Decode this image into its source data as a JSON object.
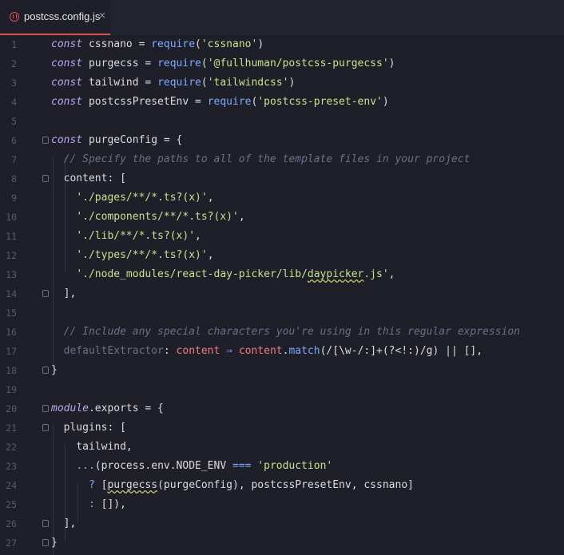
{
  "tab": {
    "title": "postcss.config.js",
    "close": "×"
  },
  "colors": {
    "accent": "#d9534f",
    "background": "#1e1f29"
  },
  "icons": {
    "tab_icon": "npm-file-icon",
    "fold": "fold-marker-icon"
  },
  "lines": [
    {
      "n": "1",
      "t": [
        {
          "c": "kw",
          "v": "const"
        },
        {
          "c": "p",
          "v": " cssnano = "
        },
        {
          "c": "fn",
          "v": "require"
        },
        {
          "c": "p",
          "v": "("
        },
        {
          "c": "str",
          "v": "'cssnano'"
        },
        {
          "c": "p",
          "v": ")"
        }
      ]
    },
    {
      "n": "2",
      "t": [
        {
          "c": "kw",
          "v": "const"
        },
        {
          "c": "p",
          "v": " purgecss = "
        },
        {
          "c": "fn",
          "v": "require"
        },
        {
          "c": "p",
          "v": "("
        },
        {
          "c": "str",
          "v": "'@fullhuman/postcss-purgecss'"
        },
        {
          "c": "p",
          "v": ")"
        }
      ]
    },
    {
      "n": "3",
      "t": [
        {
          "c": "kw",
          "v": "const"
        },
        {
          "c": "p",
          "v": " tailwind = "
        },
        {
          "c": "fn",
          "v": "require"
        },
        {
          "c": "p",
          "v": "("
        },
        {
          "c": "str",
          "v": "'tailwindcss'"
        },
        {
          "c": "p",
          "v": ")"
        }
      ]
    },
    {
      "n": "4",
      "t": [
        {
          "c": "kw",
          "v": "const"
        },
        {
          "c": "p",
          "v": " postcssPresetEnv = "
        },
        {
          "c": "fn",
          "v": "require"
        },
        {
          "c": "p",
          "v": "("
        },
        {
          "c": "str",
          "v": "'postcss-preset-env'"
        },
        {
          "c": "p",
          "v": ")"
        }
      ]
    },
    {
      "n": "5",
      "t": []
    },
    {
      "n": "6",
      "fold": true,
      "t": [
        {
          "c": "kw",
          "v": "const"
        },
        {
          "c": "p",
          "v": " purgeConfig = {"
        }
      ]
    },
    {
      "n": "7",
      "t": [
        {
          "c": "cm",
          "v": "  // Specify the paths to all of the template files in your project"
        }
      ]
    },
    {
      "n": "8",
      "fold": true,
      "t": [
        {
          "c": "p",
          "v": "  content: ["
        }
      ]
    },
    {
      "n": "9",
      "t": [
        {
          "c": "p",
          "v": "    "
        },
        {
          "c": "str",
          "v": "'./pages/**/*.ts?(x)'"
        },
        {
          "c": "p",
          "v": ","
        }
      ]
    },
    {
      "n": "10",
      "t": [
        {
          "c": "p",
          "v": "    "
        },
        {
          "c": "str",
          "v": "'./components/**/*.ts?(x)'"
        },
        {
          "c": "p",
          "v": ","
        }
      ]
    },
    {
      "n": "11",
      "t": [
        {
          "c": "p",
          "v": "    "
        },
        {
          "c": "str",
          "v": "'./lib/**/*.ts?(x)'"
        },
        {
          "c": "p",
          "v": ","
        }
      ]
    },
    {
      "n": "12",
      "t": [
        {
          "c": "p",
          "v": "    "
        },
        {
          "c": "str",
          "v": "'./types/**/*.ts?(x)'"
        },
        {
          "c": "p",
          "v": ","
        }
      ]
    },
    {
      "n": "13",
      "t": [
        {
          "c": "p",
          "v": "    "
        },
        {
          "c": "str",
          "v": "'./node_modules/react-day-picker/lib/"
        },
        {
          "c": "str sq",
          "v": "daypicker"
        },
        {
          "c": "str",
          "v": ".js'"
        },
        {
          "c": "p",
          "v": ","
        }
      ]
    },
    {
      "n": "14",
      "fold": true,
      "t": [
        {
          "c": "p",
          "v": "  ],"
        }
      ]
    },
    {
      "n": "15",
      "t": []
    },
    {
      "n": "16",
      "t": [
        {
          "c": "cm",
          "v": "  // Include any special characters you're using in this regular expression"
        }
      ]
    },
    {
      "n": "17",
      "t": [
        {
          "c": "dim",
          "v": "  defaultExtractor"
        },
        {
          "c": "p",
          "v": ": "
        },
        {
          "c": "op",
          "v": "content"
        },
        {
          "c": "p",
          "v": " "
        },
        {
          "c": "fn",
          "v": "⇒"
        },
        {
          "c": "p",
          "v": " "
        },
        {
          "c": "op",
          "v": "content"
        },
        {
          "c": "p",
          "v": "."
        },
        {
          "c": "fn",
          "v": "match"
        },
        {
          "c": "p",
          "v": "(/[\\w-/:]+(?<!:)/g) || [],"
        }
      ]
    },
    {
      "n": "18",
      "fold": true,
      "t": [
        {
          "c": "p",
          "v": "}"
        }
      ]
    },
    {
      "n": "19",
      "t": []
    },
    {
      "n": "20",
      "fold": true,
      "t": [
        {
          "c": "kw",
          "v": "module"
        },
        {
          "c": "p",
          "v": ".exports = {"
        }
      ]
    },
    {
      "n": "21",
      "fold": true,
      "t": [
        {
          "c": "p",
          "v": "  plugins: ["
        }
      ]
    },
    {
      "n": "22",
      "t": [
        {
          "c": "p",
          "v": "    tailwind,"
        }
      ]
    },
    {
      "n": "23",
      "t": [
        {
          "c": "p",
          "v": "    "
        },
        {
          "c": "fn",
          "v": "..."
        },
        {
          "c": "p",
          "v": "(process.env.NODE_ENV "
        },
        {
          "c": "fn",
          "v": "==="
        },
        {
          "c": "p",
          "v": " "
        },
        {
          "c": "str",
          "v": "'production'"
        }
      ]
    },
    {
      "n": "24",
      "t": [
        {
          "c": "p",
          "v": "      "
        },
        {
          "c": "fn",
          "v": "?"
        },
        {
          "c": "p",
          "v": " ["
        },
        {
          "c": "p sq",
          "v": "purgecss"
        },
        {
          "c": "p",
          "v": "(purgeConfig), postcssPresetEnv, cssnano]"
        }
      ]
    },
    {
      "n": "25",
      "t": [
        {
          "c": "p",
          "v": "      "
        },
        {
          "c": "fn",
          "v": ":"
        },
        {
          "c": "p",
          "v": " []),"
        }
      ]
    },
    {
      "n": "26",
      "fold": true,
      "t": [
        {
          "c": "p",
          "v": "  ],"
        }
      ]
    },
    {
      "n": "27",
      "fold": true,
      "t": [
        {
          "c": "p",
          "v": "}"
        }
      ]
    }
  ]
}
